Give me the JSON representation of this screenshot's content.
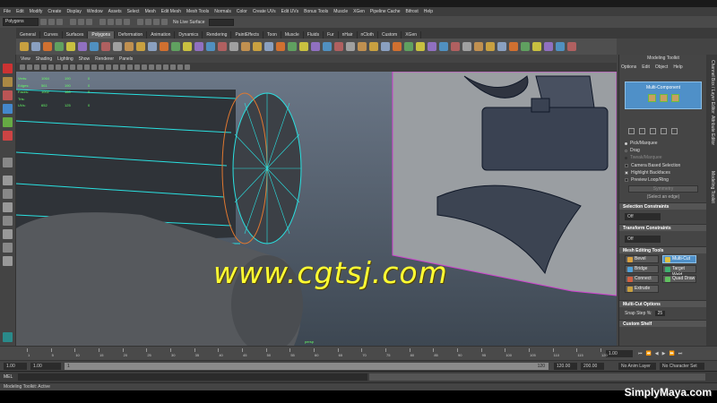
{
  "menu": [
    "File",
    "Edit",
    "Modify",
    "Create",
    "Display",
    "Window",
    "Assets",
    "Select",
    "Mesh",
    "Edit Mesh",
    "Mesh Tools",
    "Normals",
    "Color",
    "Create UVs",
    "Edit UVs",
    "Bonus Tools",
    "Muscle",
    "XGen",
    "Pipeline Cache",
    "Bifrost",
    "Help"
  ],
  "status": {
    "mode": "Polygons",
    "live_surface": "No Live Surface"
  },
  "shelf_tabs": [
    {
      "label": "General"
    },
    {
      "label": "Curves"
    },
    {
      "label": "Surfaces"
    },
    {
      "label": "Polygons",
      "active": true
    },
    {
      "label": "Deformation"
    },
    {
      "label": "Animation"
    },
    {
      "label": "Dynamics"
    },
    {
      "label": "Rendering"
    },
    {
      "label": "PaintEffects"
    },
    {
      "label": "Toon"
    },
    {
      "label": "Muscle"
    },
    {
      "label": "Fluids"
    },
    {
      "label": "Fur"
    },
    {
      "label": "nHair"
    },
    {
      "label": "nCloth"
    },
    {
      "label": "Custom"
    },
    {
      "label": "XGen"
    }
  ],
  "viewport": {
    "menu": [
      "View",
      "Shading",
      "Lighting",
      "Show",
      "Renderer",
      "Panels"
    ],
    "hud": [
      {
        "label": "Verts:",
        "a": "1064",
        "b": "190",
        "c": "0"
      },
      {
        "label": "Edges:",
        "a": "561",
        "b": "190",
        "c": "0"
      },
      {
        "label": "Faces:",
        "a": "1002",
        "b": "160",
        "c": "0"
      },
      {
        "label": "Tris:",
        "a": "",
        "b": "",
        "c": ""
      },
      {
        "label": "UVs:",
        "a": "652",
        "b": "125",
        "c": "0"
      }
    ],
    "camera": "persp",
    "watermark": "www.cgtsj.com"
  },
  "toolkit": {
    "title": "Modeling Toolkit",
    "menu": [
      "Options",
      "Edit",
      "Object",
      "Help"
    ],
    "multi_component": "Multi-Component",
    "options": {
      "pick_marquee": "Pick/Marquee",
      "drag": "Drag",
      "tweak_marquee": "Tweak/Marquee",
      "camera_based": "Camera Based Selection",
      "highlight_backfaces": "Highlight Backfaces",
      "preview_loop": "Preview Loop/Ring",
      "symmetry": "Symmetry",
      "select_edge_hint": "(Select an edge)"
    },
    "selection_constraints": {
      "title": "Selection Constraints",
      "value": "Off"
    },
    "transform_constraints": {
      "title": "Transform Constraints",
      "value": "Off"
    },
    "mesh_editing_tools": {
      "title": "Mesh Editing Tools",
      "buttons": [
        {
          "label": "Bevel",
          "color": "#d8a040"
        },
        {
          "label": "Multi-Cut",
          "color": "#e0c040",
          "active": true
        },
        {
          "label": "Bridge",
          "color": "#50a0d8"
        },
        {
          "label": "Target Weld",
          "color": "#40b070"
        },
        {
          "label": "Connect",
          "color": "#d06040"
        },
        {
          "label": "Quad Draw",
          "color": "#60c060"
        },
        {
          "label": "Extrude",
          "color": "#c8a040"
        }
      ]
    },
    "multi_cut_options": {
      "title": "Multi-Cut Options",
      "snap_label": "Snap Step %:",
      "snap_value": "25"
    },
    "custom_shelf": "Custom Shelf"
  },
  "side_tabs": [
    "Channel Box / Layer Editor",
    "Attribute Editor",
    "Modeling Toolkit"
  ],
  "timeline": {
    "ticks": [
      "1",
      "5",
      "10",
      "15",
      "20",
      "25",
      "30",
      "35",
      "40",
      "45",
      "50",
      "55",
      "60",
      "65",
      "70",
      "75",
      "80",
      "85",
      "90",
      "95",
      "100",
      "105",
      "110",
      "115",
      "120"
    ],
    "current": "1.00"
  },
  "range": {
    "start": "1.00",
    "start2": "1.00",
    "slider_start": "1",
    "slider_end": "120",
    "end": "120.00",
    "end2": "200.00",
    "anim_layer": "No Anim Layer",
    "char_set": "No Character Set"
  },
  "cmd": {
    "label": "MEL"
  },
  "help_line": "Modeling Toolkit: Active",
  "brand": "SimplyMaya.com",
  "colors": {
    "accent": "#4f90c8",
    "watermark": "#ffff33"
  }
}
